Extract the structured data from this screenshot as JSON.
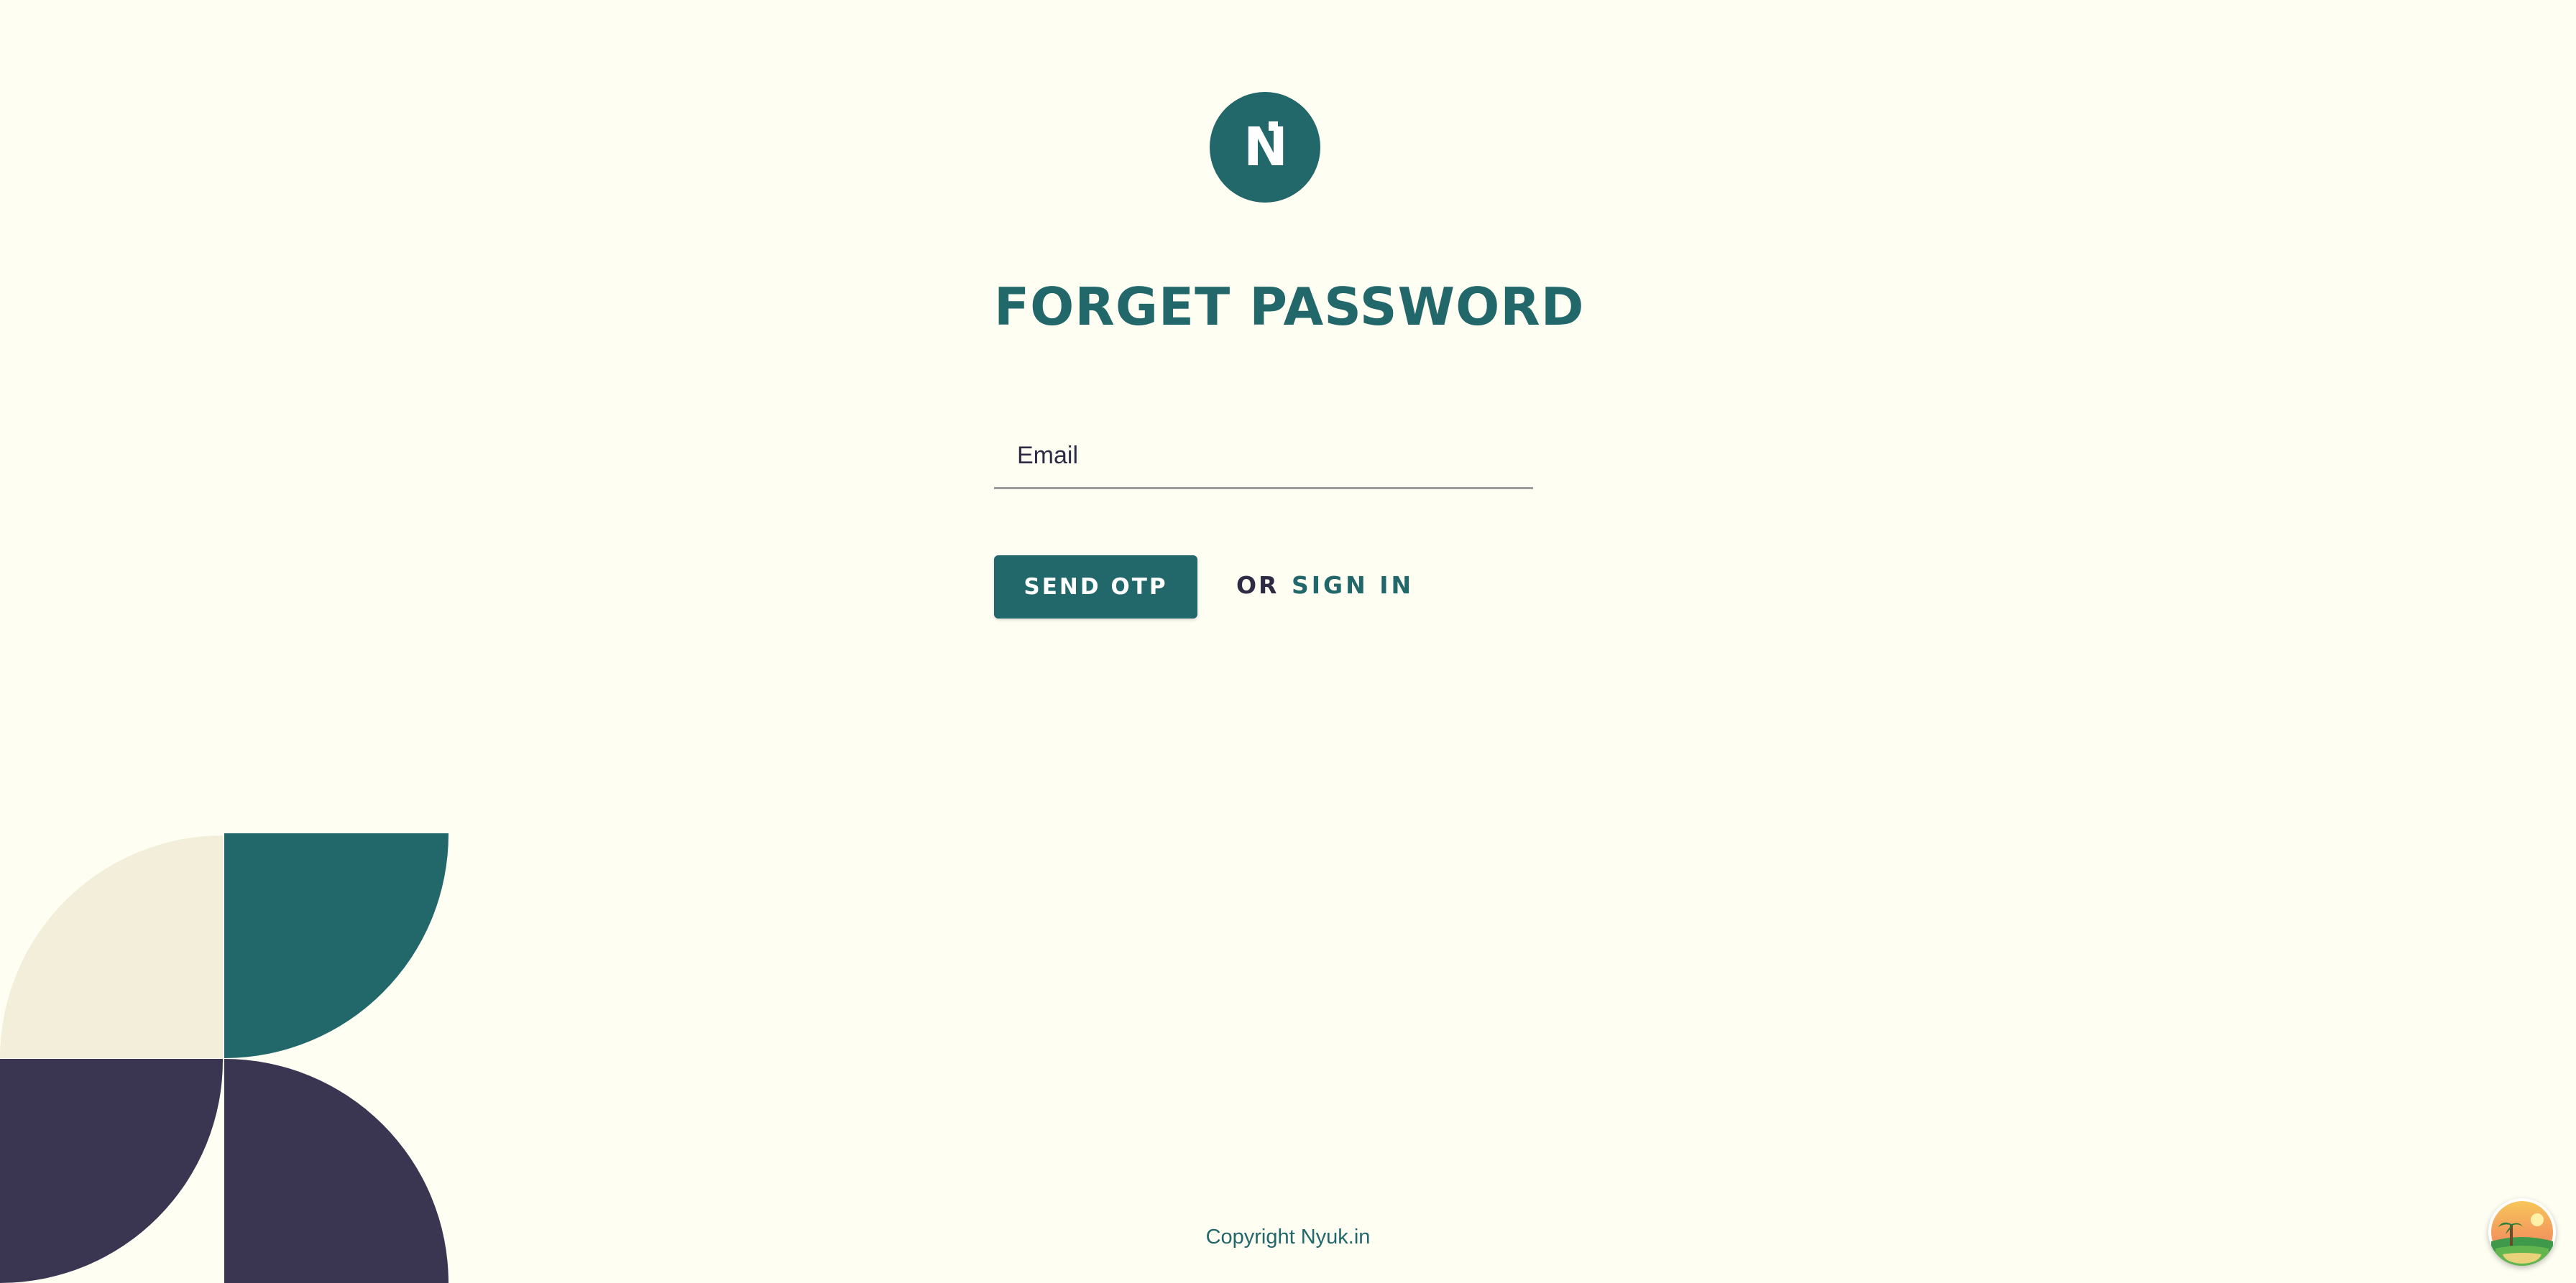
{
  "logo": {
    "text": "N",
    "icon": "nyuk-logo-icon"
  },
  "page": {
    "title": "FORGET PASSWORD"
  },
  "form": {
    "email_placeholder": "Email",
    "email_value": ""
  },
  "actions": {
    "send_otp_label": "SEND OTP",
    "or_label": "OR",
    "sign_in_label": "SIGN IN"
  },
  "footer": {
    "copyright": "Copyright Nyuk.in"
  },
  "widget": {
    "icon": "beach-scene-icon"
  },
  "colors": {
    "background": "#fefef3",
    "primary": "#22676a",
    "dark": "#3a3651",
    "cream": "#f3eed9",
    "divider": "#9a9a9f"
  }
}
